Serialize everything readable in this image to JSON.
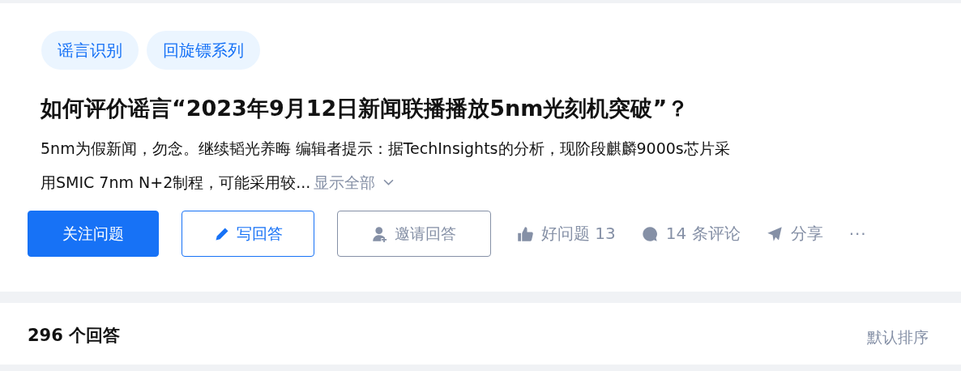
{
  "tags": [
    "谣言识别",
    "回旋镖系列"
  ],
  "question": {
    "title": "如何评价谣言“2023年9月12日新闻联播播放5nm光刻机突破”？",
    "excerpt": [
      "5nm为假新闻，勿念。继续韬光养晦 编辑者提示：据TechInsights的分析，现阶段麒麟9000s芯片采",
      "用SMIC 7nm N+2制程，可能采用较..."
    ],
    "expand": "显示全部"
  },
  "buttons": [
    {
      "kind": "primary",
      "label": "关注问题"
    },
    {
      "kind": "outline",
      "label": "写回答"
    },
    {
      "kind": "plain",
      "label": "邀请回答"
    }
  ],
  "actions": [
    {
      "kind": "like",
      "label": "好问题 13"
    },
    {
      "kind": "comment",
      "label": "14 条评论"
    },
    {
      "kind": "share",
      "label": "分享"
    },
    {
      "kind": "more",
      "label": "···"
    }
  ],
  "answers": {
    "count": "296 个回答",
    "sort": "默认排序"
  }
}
